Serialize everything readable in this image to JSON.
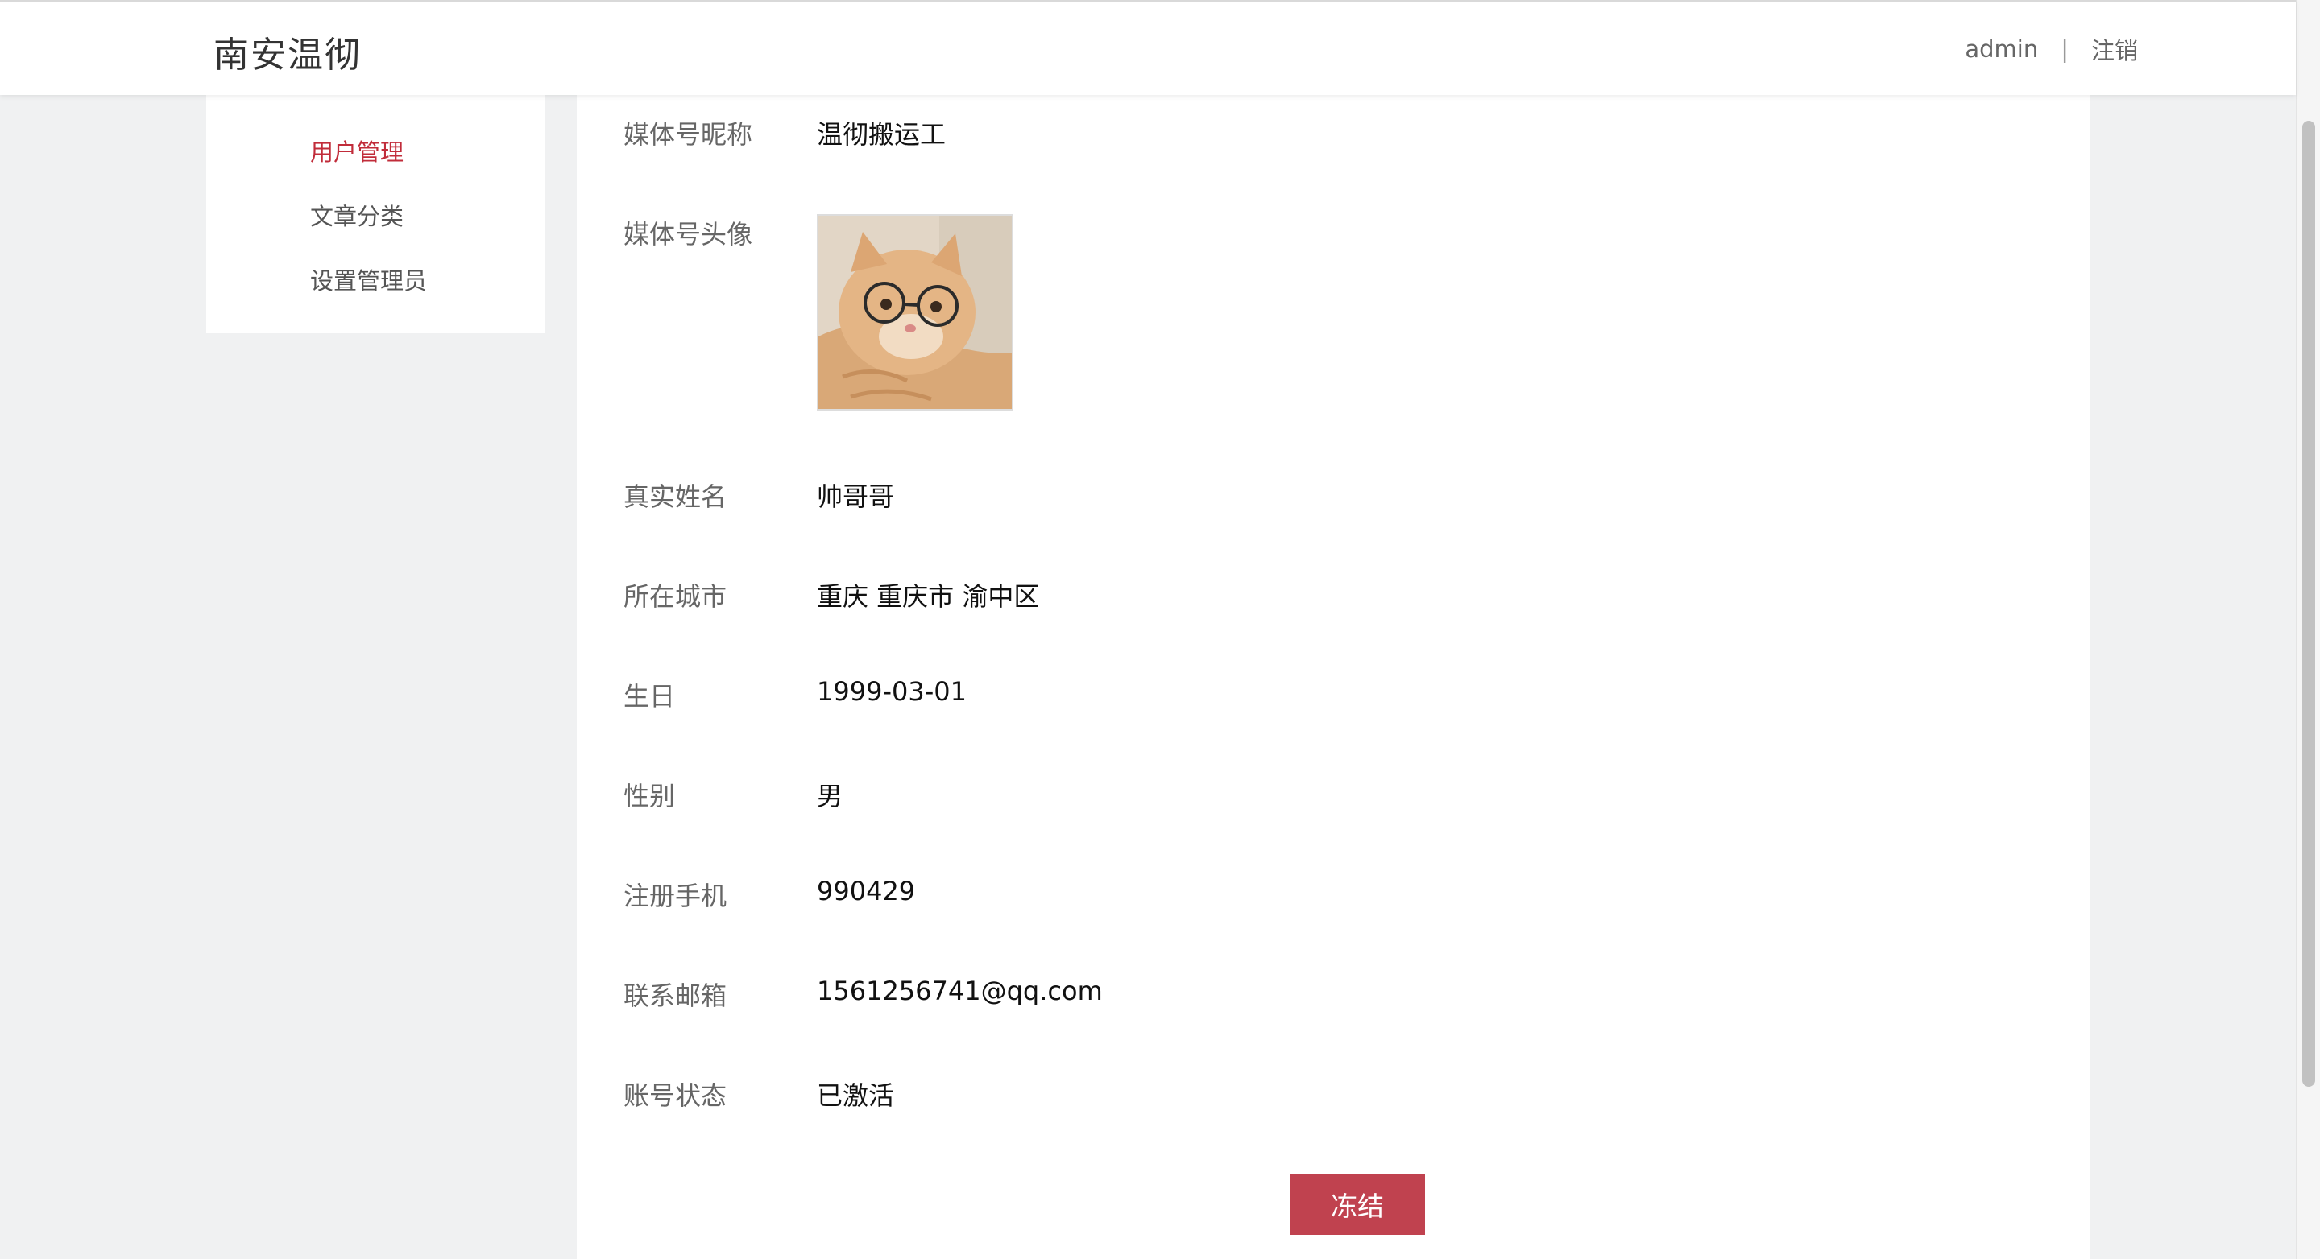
{
  "header": {
    "logo": "南安温彻",
    "user": "admin",
    "separator": "|",
    "logout": "注销"
  },
  "sidebar": {
    "items": [
      {
        "label": "用户管理",
        "active": true
      },
      {
        "label": "文章分类",
        "active": false
      },
      {
        "label": "设置管理员",
        "active": false
      }
    ]
  },
  "profile": {
    "media_name_label": "媒体号昵称",
    "media_name": "温彻搬运工",
    "avatar_label": "媒体号头像",
    "real_name_label": "真实姓名",
    "real_name": "帅哥哥",
    "city_label": "所在城市",
    "city": "重庆 重庆市 渝中区",
    "birthday_label": "生日",
    "birthday": "1999-03-01",
    "gender_label": "性别",
    "gender": "男",
    "phone_label": "注册手机",
    "phone": "990429",
    "email_label": "联系邮箱",
    "email": "1561256741@qq.com",
    "status_label": "账号状态",
    "status": "已激活"
  },
  "actions": {
    "freeze_label": "冻结"
  },
  "colors": {
    "accent": "#c12c3a",
    "button": "#c0424f"
  },
  "icons": {
    "avatar": "cat-with-glasses-avatar"
  }
}
